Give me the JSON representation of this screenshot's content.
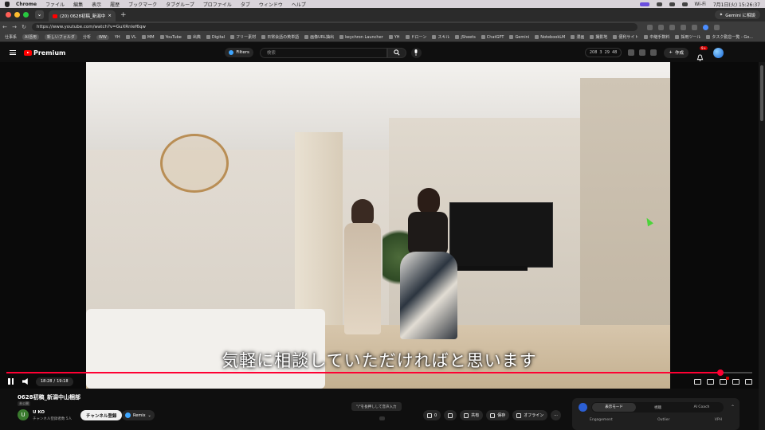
{
  "menubar": {
    "app": "Chrome",
    "items": [
      "ファイル",
      "編集",
      "表示",
      "履歴",
      "ブックマーク",
      "タブグループ",
      "プロファイル",
      "タブ",
      "ウィンドウ",
      "ヘルプ"
    ],
    "right": [
      "Wi-Fi",
      "7月1日(火) 15:26:37"
    ]
  },
  "browser": {
    "tab_title": "(20) 0628初稿_新潟中山...",
    "gemini_label": "Gemini に相談",
    "url": "https://www.youtube.com/watch?v=GuXRnlef6qw",
    "bookmarks": [
      "仕事系",
      "AI活用",
      "新しいフォルダ",
      "分析",
      "WW",
      "YH",
      "VL",
      "MM",
      "YouTube",
      "出典",
      "Digital",
      "フリー素材",
      "日常会話の英単語",
      "画像URL抽出",
      "keychron Launcher",
      "YH",
      "ドローン",
      "スキル",
      "jSheets",
      "ChatGPT",
      "Gemini",
      "NotebookLM",
      "漫画",
      "撮影地",
      "便利サイト",
      "中継手数料",
      "採用ツール",
      "タスク勤怠一覧 - Go..."
    ]
  },
  "youtube": {
    "premium_label": "Premium",
    "filters_label": "Filters",
    "search_placeholder": "検索",
    "stats": [
      "208",
      "3",
      "29",
      "48"
    ],
    "create_label": "作成",
    "notif_count": "9+"
  },
  "player": {
    "subtitle": "気軽に相談していただければと思います",
    "time_current": "18:28",
    "time_total": "19:18",
    "progress": 0.957
  },
  "video_info": {
    "title": "0628初稿_新潟中山梱部",
    "badge": "未公開",
    "channel_initial": "U",
    "channel_name": "U KO",
    "subscribers": "チャンネル登録者数 5人",
    "subscribe_label": "チャンネル登録",
    "remix_label": "Remix",
    "hint": "\"/\"を長押しして音声入力",
    "like_count": "0",
    "share_label": "共有",
    "save_label": "保存",
    "offline_label": "オフライン"
  },
  "side_panel": {
    "tabs": [
      "表示モード",
      "視聴",
      "AI Coach"
    ],
    "labels": [
      "Engagement",
      "Outlier",
      "VPH"
    ]
  },
  "colors": {
    "accent_red": "#ff0033",
    "youtube_red": "#ff0000",
    "background": "#0f0f0f"
  }
}
